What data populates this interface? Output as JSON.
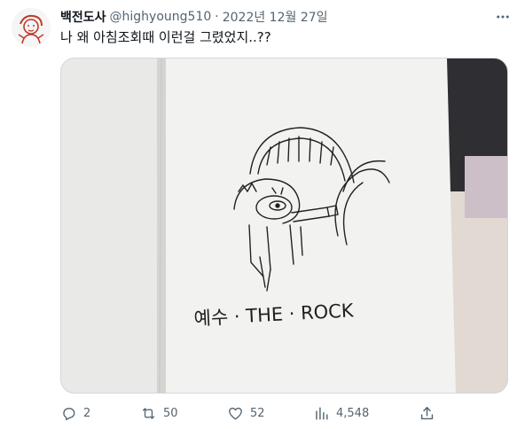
{
  "tweet": {
    "display_name": "백전도사",
    "handle": "@highyoung510",
    "separator": "·",
    "date": "2022년 12월 27일",
    "text": "나 왜 아침조회때 이런걸 그렸었지..??",
    "avatar_icon": "avatar-doodle-icon",
    "more_icon": "more-horizontal-icon"
  },
  "media": {
    "description_icon": "notebook-drawing-image",
    "drawing_caption": "예수 · THE · ROCK"
  },
  "actions": {
    "reply": {
      "icon": "reply-icon",
      "count": "2"
    },
    "retweet": {
      "icon": "retweet-icon",
      "count": "50"
    },
    "like": {
      "icon": "heart-icon",
      "count": "52"
    },
    "views": {
      "icon": "analytics-icon",
      "count": "4,548"
    },
    "share": {
      "icon": "share-icon"
    }
  },
  "colors": {
    "text_primary": "#0f1419",
    "text_secondary": "#536471",
    "border": "#cfd9de"
  }
}
